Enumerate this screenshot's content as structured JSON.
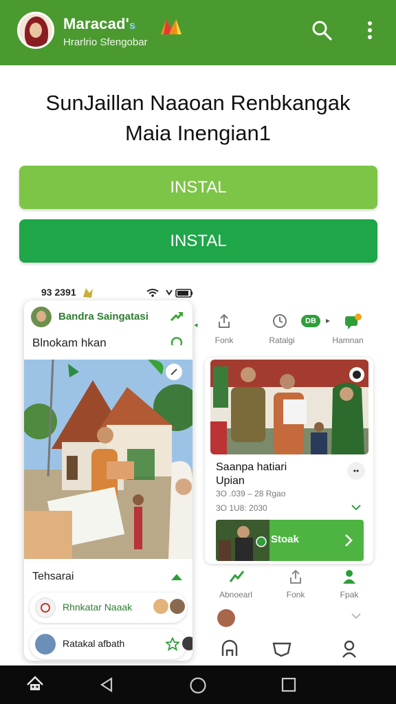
{
  "appbar": {
    "title": "Maracad'",
    "title_suffix": "s",
    "subtitle": "Hrarlrio Sfengobar",
    "icons": [
      "search-icon",
      "more-vert-icon"
    ],
    "color": "#4a9a2f"
  },
  "heading": {
    "line1": "SunJaillan Naaoan Renbkangak",
    "line2": "Maia  Inengian1"
  },
  "buttons": [
    {
      "label": "INSTAL",
      "color": "#7cc546"
    },
    {
      "label": "INSTAL",
      "color": "#1fa649"
    }
  ],
  "status_bar": {
    "time": "93 2391"
  },
  "left_card": {
    "name": "Bandra Saingatasi",
    "subtitle": "Blnokam hkan",
    "section": "Tehsarai",
    "rows": [
      {
        "label": "Rhnkatar Naaak"
      },
      {
        "label": "Ratakal afbath"
      }
    ]
  },
  "right_panel": {
    "tabs": [
      {
        "label": "Fonk",
        "icon": "share-icon"
      },
      {
        "label": "Ratalgi",
        "icon": "clock-icon"
      },
      {
        "label": "Hamnan",
        "icon": "chat-icon"
      }
    ],
    "tab_badge": "DB",
    "card": {
      "title_line1": "Saanpa hatiari",
      "title_line2": "Upian",
      "meta1": "3O .039 – 28 Rgao",
      "meta2": "3O 1U8: 2030",
      "action_label": "Stoak",
      "overflow": "••"
    },
    "bottom_nav": [
      {
        "label": "Abnoearl",
        "icon": "trending-icon"
      },
      {
        "label": "Fonk",
        "icon": "share-icon"
      },
      {
        "label": "Fpak",
        "icon": "person-icon"
      }
    ]
  },
  "system_nav": [
    "home-badge-icon",
    "back-icon",
    "home-icon",
    "recents-icon"
  ]
}
